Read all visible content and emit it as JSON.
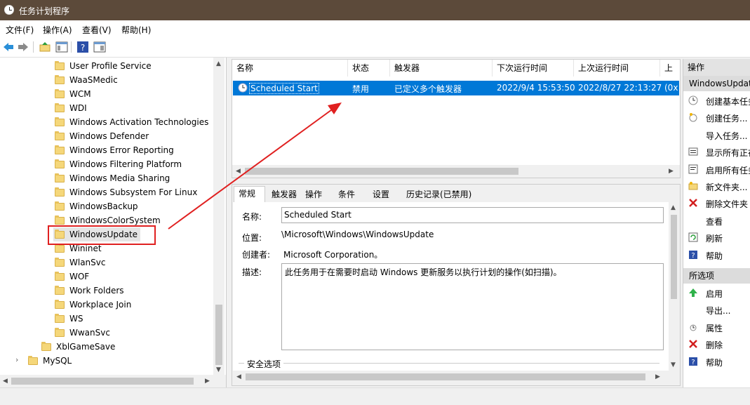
{
  "window": {
    "title": "任务计划程序"
  },
  "menu": [
    "文件(F)",
    "操作(A)",
    "查看(V)",
    "帮助(H)"
  ],
  "tree": {
    "items": [
      {
        "label": "User Profile Service",
        "level": 2
      },
      {
        "label": "WaaSMedic",
        "level": 2
      },
      {
        "label": "WCM",
        "level": 2
      },
      {
        "label": "WDI",
        "level": 2
      },
      {
        "label": "Windows Activation Technologies",
        "level": 2
      },
      {
        "label": "Windows Defender",
        "level": 2
      },
      {
        "label": "Windows Error Reporting",
        "level": 2
      },
      {
        "label": "Windows Filtering Platform",
        "level": 2
      },
      {
        "label": "Windows Media Sharing",
        "level": 2
      },
      {
        "label": "Windows Subsystem For Linux",
        "level": 2
      },
      {
        "label": "WindowsBackup",
        "level": 2
      },
      {
        "label": "WindowsColorSystem",
        "level": 2
      },
      {
        "label": "WindowsUpdate",
        "level": 2,
        "selected": true
      },
      {
        "label": "Wininet",
        "level": 2
      },
      {
        "label": "WlanSvc",
        "level": 2
      },
      {
        "label": "WOF",
        "level": 2
      },
      {
        "label": "Work Folders",
        "level": 2
      },
      {
        "label": "Workplace Join",
        "level": 2
      },
      {
        "label": "WS",
        "level": 2
      },
      {
        "label": "WwanSvc",
        "level": 2
      },
      {
        "label": "XblGameSave",
        "level": 1
      },
      {
        "label": "MySQL",
        "level": 0,
        "expandable": true
      }
    ]
  },
  "tasklist": {
    "columns": [
      "名称",
      "状态",
      "触发器",
      "下次运行时间",
      "上次运行时间",
      "上"
    ],
    "rows": [
      {
        "name": "Scheduled Start",
        "status": "禁用",
        "trigger": "已定义多个触发器",
        "next_run": "2022/9/4 15:53:50",
        "last_run": "2022/8/27 22:13:27",
        "last_result": "(0x"
      }
    ]
  },
  "detail": {
    "tabs": [
      "常规",
      "触发器",
      "操作",
      "条件",
      "设置",
      "历史记录(已禁用)"
    ],
    "name_label": "名称:",
    "name_value": "Scheduled Start",
    "location_label": "位置:",
    "location_value": "\\Microsoft\\Windows\\WindowsUpdate",
    "author_label": "创建者:",
    "author_value": "Microsoft Corporation。",
    "desc_label": "描述:",
    "desc_value": "此任务用于在需要时启动 Windows 更新服务以执行计划的操作(如扫描)。",
    "security_label": "安全选项"
  },
  "actions": {
    "header": "操作",
    "folder_section": "WindowsUpdate",
    "folder_actions": [
      "创建基本任务...",
      "创建任务...",
      "导入任务...",
      "显示所有正在运行的任务",
      "启用所有任务历史记录",
      "新文件夹...",
      "删除文件夹",
      "查看",
      "刷新",
      "帮助"
    ],
    "selected_section": "所选项",
    "selected_actions": [
      "启用",
      "导出...",
      "属性",
      "删除",
      "帮助"
    ]
  },
  "colors": {
    "accent": "#0078d7",
    "annotation": "#e02020"
  }
}
